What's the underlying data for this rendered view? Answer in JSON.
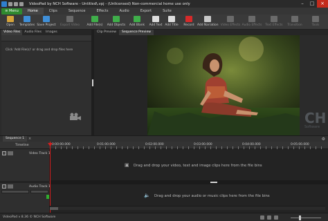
{
  "window": {
    "title": "VideoPad by NCH Software - Untitled\\.vpj - (Unlicensed) Non-commercial home use only",
    "controls": [
      "–",
      "□",
      "×"
    ]
  },
  "menubar": {
    "menu_button": "≡ Menu",
    "tabs": [
      "Home",
      "Clips",
      "Sequence",
      "Effects",
      "Audio",
      "Export",
      "Suite"
    ],
    "active_tab": "Home"
  },
  "toolbar": {
    "items": [
      {
        "label": "Open",
        "icon": "open-folder-icon",
        "color": "#d6a43a",
        "enabled": true
      },
      {
        "label": "Templates",
        "icon": "templates-icon",
        "color": "#3f8fd8",
        "enabled": true
      },
      {
        "label": "Save Project",
        "icon": "save-icon",
        "color": "#3f8fd8",
        "enabled": true
      },
      {
        "label": "Export Video",
        "icon": "export-video-icon",
        "color": "#6a6a6a",
        "enabled": false
      },
      {
        "label": "Add File(s)",
        "icon": "add-files-icon",
        "color": "#3fae4a",
        "enabled": true
      },
      {
        "label": "Add Objects",
        "icon": "add-objects-icon",
        "color": "#3fae4a",
        "enabled": true
      },
      {
        "label": "Add Blank",
        "icon": "add-blank-icon",
        "color": "#3fae4a",
        "enabled": true
      },
      {
        "label": "Add Text",
        "icon": "add-text-icon",
        "color": "#dddddd",
        "enabled": true
      },
      {
        "label": "Add Title",
        "icon": "add-title-icon",
        "color": "#dddddd",
        "enabled": true
      },
      {
        "label": "Record",
        "icon": "record-icon",
        "color": "#d62a2a",
        "enabled": true
      },
      {
        "label": "Add Narration",
        "icon": "microphone-icon",
        "color": "#c8c8c8",
        "enabled": true
      },
      {
        "label": "Video Effects",
        "icon": "video-effects-icon",
        "color": "#6a6a6a",
        "enabled": false
      },
      {
        "label": "Audio Effects",
        "icon": "audio-effects-icon",
        "color": "#6a6a6a",
        "enabled": false
      },
      {
        "label": "Text Effects",
        "icon": "text-effects-icon",
        "color": "#6a6a6a",
        "enabled": false
      },
      {
        "label": "Transition",
        "icon": "transition-icon",
        "color": "#6a6a6a",
        "enabled": false
      },
      {
        "label": "Tools",
        "icon": "tools-icon",
        "color": "#6a6a6a",
        "enabled": false
      }
    ]
  },
  "bins": {
    "tabs": [
      "Video Files",
      "Audio Files",
      "Images"
    ],
    "active_tab": "Video Files",
    "hint": "Click 'Add File(s)' or drag and drop files here"
  },
  "preview": {
    "tabs": [
      "Clip Preview",
      "Sequence Preview"
    ],
    "active_tab": "Sequence Preview",
    "logo": {
      "letters": "CH",
      "word": "Software"
    }
  },
  "sequence": {
    "tab": "Sequence 1",
    "close": "×",
    "timeline_label": "Timeline",
    "ticks": [
      "0:00:00.000",
      "0:01:00.000",
      "0:02:00.000",
      "0:03:00.000",
      "0:04:00.000",
      "0:05:00.000"
    ],
    "video_track": "Video Track 1",
    "audio_track": "Audio Track 1",
    "video_drop": "Drag and drop your video, text and image clips here from the file bins",
    "audio_drop": "Drag and drop your audio or music clips here from the file bins"
  },
  "status": {
    "text": "VideoPad v 8.36 © NCH Software"
  },
  "colors": {
    "accent_green": "#2f8a2f",
    "playhead": "#d61e1e",
    "close_red": "#c42b1c"
  }
}
